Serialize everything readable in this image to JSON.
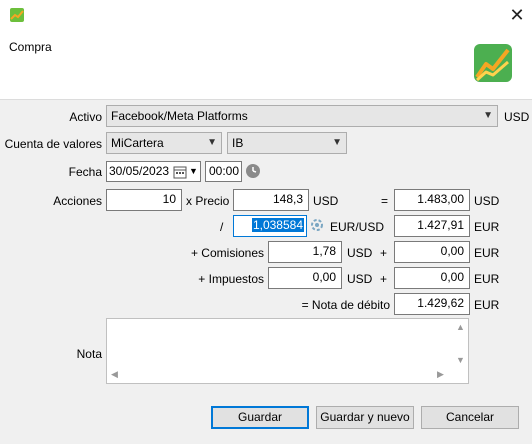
{
  "window": {
    "close_glyph": "✕"
  },
  "header": {
    "title": "Compra"
  },
  "form": {
    "activo_label": "Activo",
    "activo_value": "Facebook/Meta Platforms",
    "activo_currency": "USD",
    "cuenta_label": "Cuenta de valores",
    "cuenta_value": "MiCartera",
    "broker_value": "IB",
    "fecha_label": "Fecha",
    "fecha_value": "30/05/2023",
    "hora_value": "00:00",
    "acciones_label": "Acciones",
    "acciones_value": "10",
    "precio_label": "x Precio",
    "precio_value": "148,3",
    "precio_currency": "USD",
    "equals": "=",
    "total_usd_value": "1.483,00",
    "total_usd_currency": "USD",
    "divide": "/",
    "fx_value": "1,038584",
    "fx_unit": "EUR/USD",
    "total_eur_value": "1.427,91",
    "total_eur_currency": "EUR",
    "comisiones_label": "+ Comisiones",
    "comisiones_value": "1,78",
    "comisiones_currency": "USD",
    "plus1": "+",
    "comisiones_eur_value": "0,00",
    "comisiones_eur_currency": "EUR",
    "impuestos_label": "+ Impuestos",
    "impuestos_value": "0,00",
    "impuestos_currency": "USD",
    "plus2": "+",
    "impuestos_eur_value": "0,00",
    "impuestos_eur_currency": "EUR",
    "nota_debito_label": "= Nota de débito",
    "nota_debito_value": "1.429,62",
    "nota_debito_currency": "EUR",
    "nota_label": "Nota",
    "nota_value": ""
  },
  "buttons": {
    "save": "Guardar",
    "save_new": "Guardar y nuevo",
    "cancel": "Cancelar"
  },
  "colors": {
    "accent": "#0078d7",
    "logo_green": "#4caf50",
    "logo_orange": "#f5a623"
  }
}
